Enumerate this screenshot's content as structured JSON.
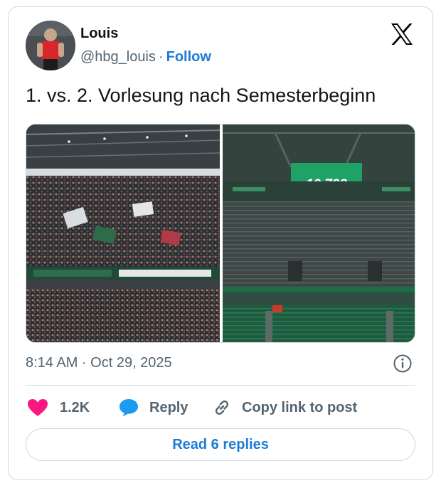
{
  "author": {
    "name": "Louis",
    "handle": "@hbg_louis",
    "separator": "·",
    "follow_label": "Follow"
  },
  "tweet": {
    "text": "1. vs. 2. Vorlesung nach Semesterbeginn",
    "timestamp": "8:14 AM · Oct 29, 2025",
    "media": [
      {
        "description": "crowded stadium stands"
      },
      {
        "scoreboard_text": "10.793",
        "description": "empty stadium stands"
      }
    ]
  },
  "actions": {
    "like_count": "1.2K",
    "reply_label": "Reply",
    "copy_label": "Copy link to post"
  },
  "read_replies_label": "Read 6 replies",
  "icons": {
    "brand": "x-logo-icon",
    "like": "heart-icon",
    "reply": "speech-bubble-icon",
    "copy": "link-icon",
    "info": "info-icon"
  },
  "colors": {
    "accent": "#1d7bd8",
    "like": "#f91880",
    "reply_icon": "#1d9bf0",
    "muted_text": "#536471",
    "border": "#cfd9de"
  }
}
